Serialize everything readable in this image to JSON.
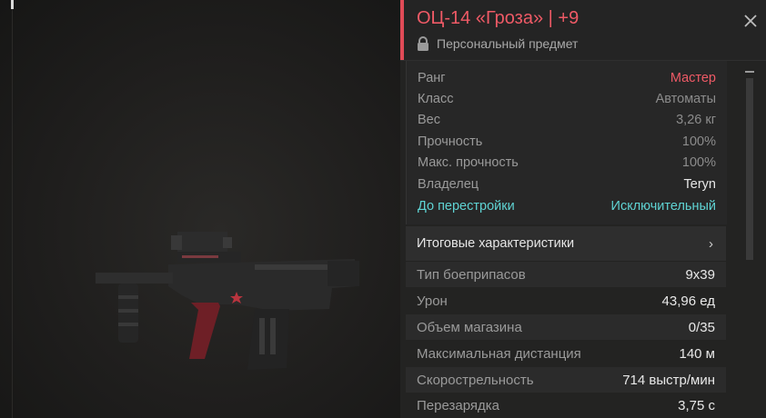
{
  "item": {
    "title": "ОЦ-14 «Гроза» | +9",
    "subtitle": "Персональный предмет"
  },
  "colors": {
    "accent": "#e04b57",
    "rank_value": "#ef5a66",
    "rebuild": "#5fd3d3"
  },
  "info": [
    {
      "label": "Ранг",
      "value": "Мастер"
    },
    {
      "label": "Класс",
      "value": "Автоматы"
    },
    {
      "label": "Вес",
      "value": "3,26 кг"
    },
    {
      "label": "Прочность",
      "value": "100%"
    },
    {
      "label": "Макс. прочность",
      "value": "100%"
    },
    {
      "label": "Владелец",
      "value": "Teryn"
    },
    {
      "label": "До перестройки",
      "value": "Исключительный"
    }
  ],
  "section": {
    "label": "Итоговые характеристики",
    "chevron": "›"
  },
  "stats": [
    {
      "label": "Тип боеприпасов",
      "value": "9x39"
    },
    {
      "label": "Урон",
      "value": "43,96 ед"
    },
    {
      "label": "Объем магазина",
      "value": "0/35"
    },
    {
      "label": "Максимальная дистанция",
      "value": "140 м"
    },
    {
      "label": "Скорострельность",
      "value": "714 выстр/мин"
    },
    {
      "label": "Перезарядка",
      "value": "3,75 с"
    }
  ],
  "icons": {
    "lock": "lock-icon",
    "close": "close-icon",
    "weapon": "weapon-model"
  }
}
